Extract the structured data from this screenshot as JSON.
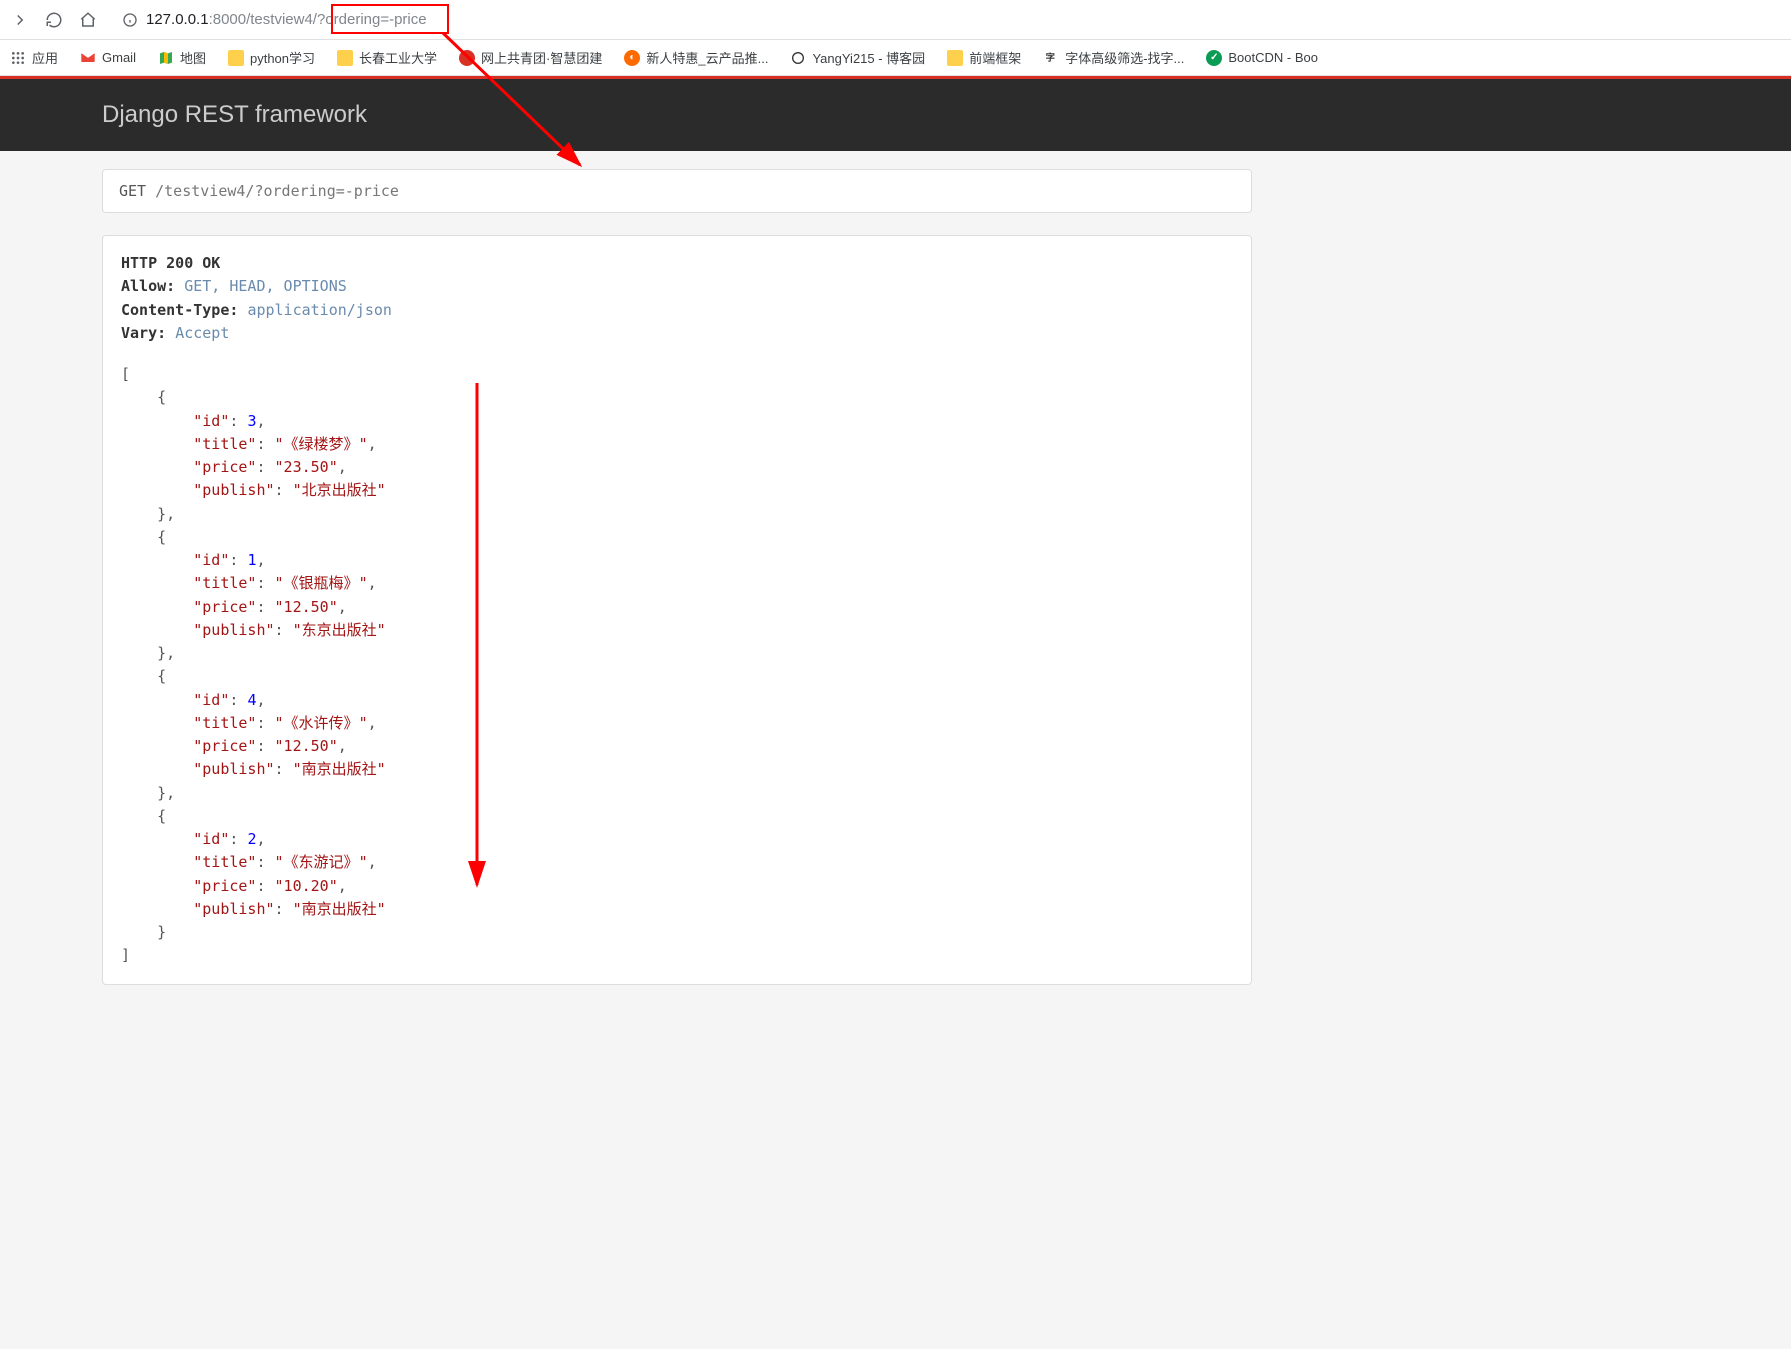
{
  "browser": {
    "url_prefix": "127.0.0.1",
    "url_path": ":8000/testview4/?ordering=-price"
  },
  "bookmarks": [
    {
      "label": "应用",
      "icon": "apps"
    },
    {
      "label": "Gmail",
      "icon": "gmail"
    },
    {
      "label": "地图",
      "icon": "map"
    },
    {
      "label": "python学习",
      "icon": "folder"
    },
    {
      "label": "长春工业大学",
      "icon": "folder"
    },
    {
      "label": "网上共青团·智慧团建",
      "icon": "red"
    },
    {
      "label": "新人特惠_云产品推...",
      "icon": "cloud"
    },
    {
      "label": "YangYi215 - 博客园",
      "icon": "blog"
    },
    {
      "label": "前端框架",
      "icon": "folder"
    },
    {
      "label": "字体高级筛选-找字...",
      "icon": "font"
    },
    {
      "label": "BootCDN - Boo",
      "icon": "bootcdn"
    }
  ],
  "drf": {
    "title": "Django REST framework",
    "request_method": "GET",
    "request_path": "/testview4/?ordering=-price",
    "status_line": "HTTP 200 OK",
    "headers": {
      "Allow": "GET, HEAD, OPTIONS",
      "Content-Type": "application/json",
      "Vary": "Accept"
    },
    "body": [
      {
        "id": 3,
        "title": "《绿楼梦》",
        "price": "23.50",
        "publish": "北京出版社"
      },
      {
        "id": 1,
        "title": "《银瓶梅》",
        "price": "12.50",
        "publish": "东京出版社"
      },
      {
        "id": 4,
        "title": "《水许传》",
        "price": "12.50",
        "publish": "南京出版社"
      },
      {
        "id": 2,
        "title": "《东游记》",
        "price": "10.20",
        "publish": "南京出版社"
      }
    ]
  }
}
